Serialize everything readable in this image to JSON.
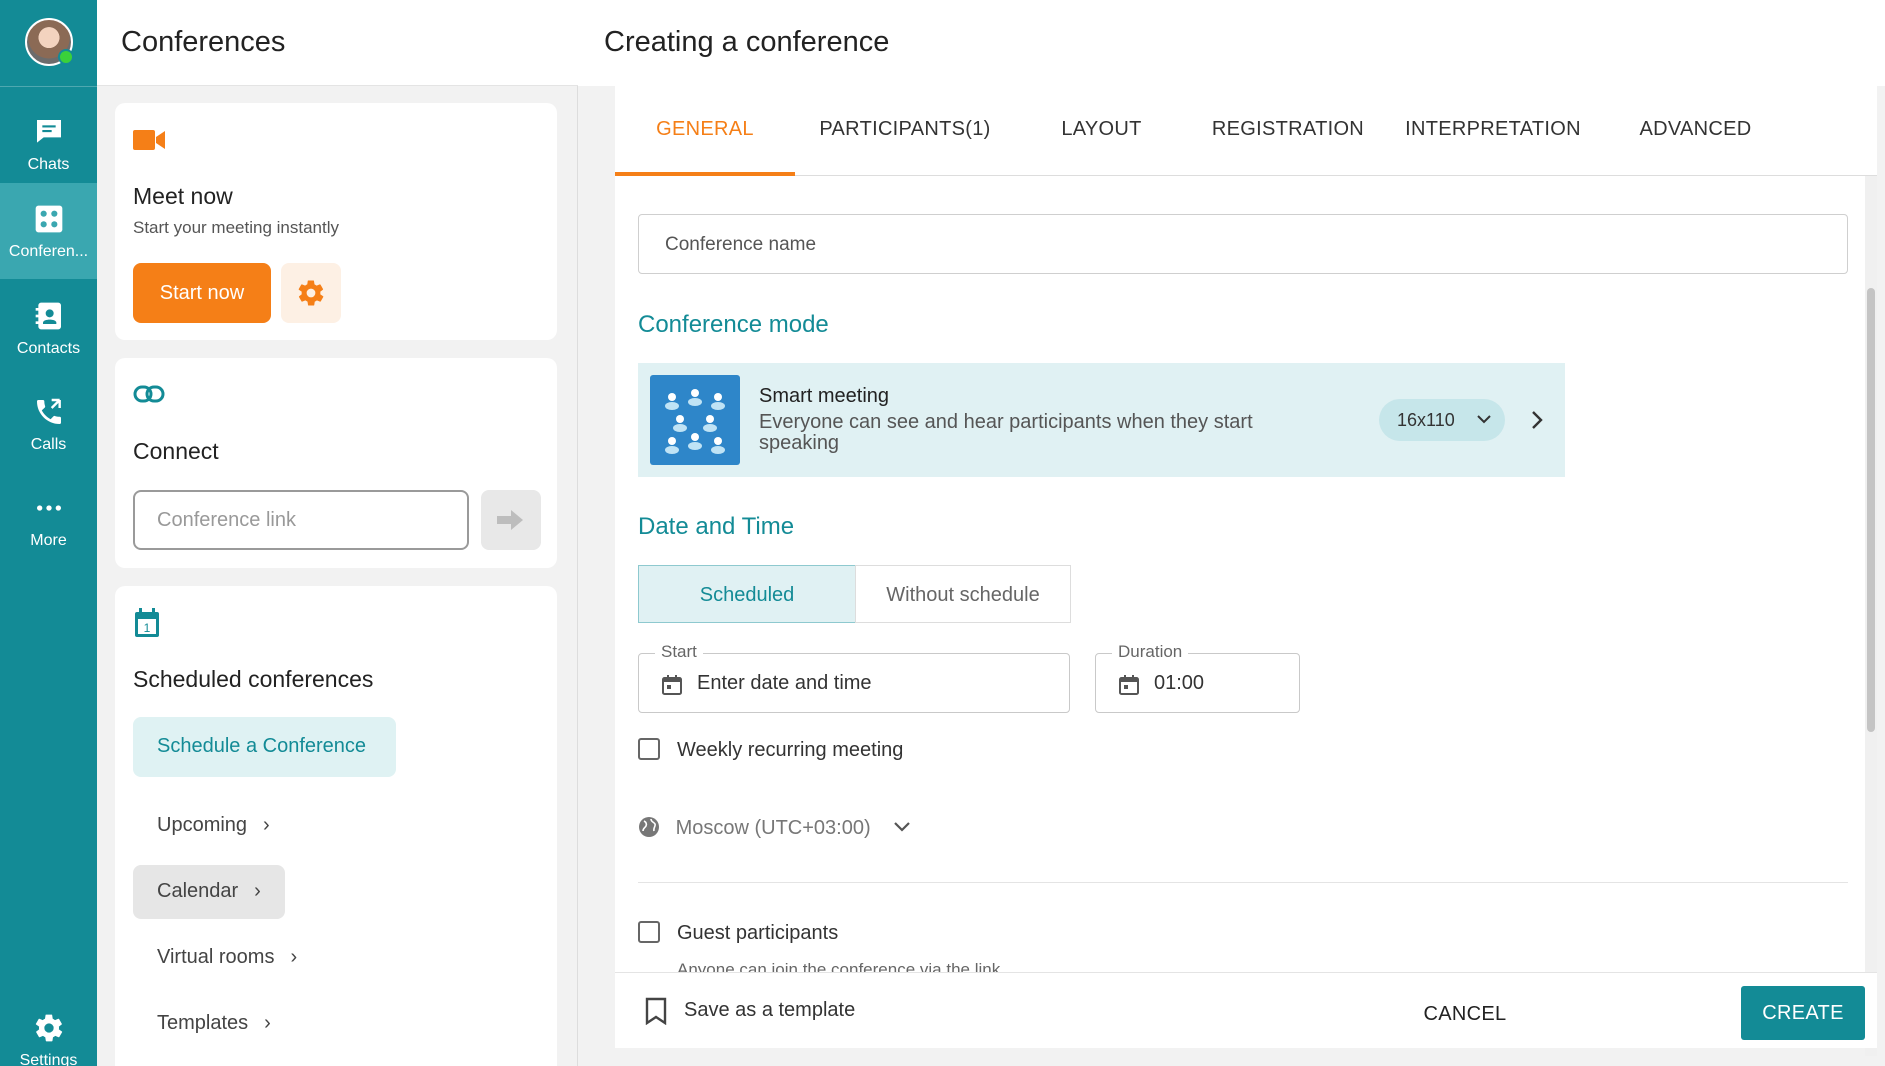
{
  "rail": {
    "items": [
      {
        "label": "Chats",
        "icon": "chat-icon"
      },
      {
        "label": "Conferen...",
        "icon": "conference-icon"
      },
      {
        "label": "Contacts",
        "icon": "contacts-icon"
      },
      {
        "label": "Calls",
        "icon": "phone-icon"
      },
      {
        "label": "More",
        "icon": "more-icon"
      },
      {
        "label": "Settings",
        "icon": "gear-icon"
      }
    ],
    "accent": "#138b96"
  },
  "left": {
    "title": "Conferences",
    "meet_now": {
      "title": "Meet now",
      "subtitle": "Start your meeting instantly",
      "start_label": "Start now"
    },
    "connect": {
      "title": "Connect",
      "placeholder": "Conference link"
    },
    "scheduled": {
      "title": "Scheduled conferences",
      "schedule_label": "Schedule a Conference",
      "menu": [
        {
          "label": "Upcoming"
        },
        {
          "label": "Calendar"
        },
        {
          "label": "Virtual rooms"
        },
        {
          "label": "Templates"
        }
      ]
    }
  },
  "main": {
    "title": "Creating a conference",
    "tabs": [
      {
        "label": "GENERAL"
      },
      {
        "label": "PARTICIPANTS(1)"
      },
      {
        "label": "LAYOUT"
      },
      {
        "label": "REGISTRATION"
      },
      {
        "label": "INTERPRETATION"
      },
      {
        "label": "ADVANCED"
      }
    ],
    "name_placeholder": "Conference name",
    "mode_section": "Conference mode",
    "mode": {
      "name": "Smart meeting",
      "description": "Everyone can see and hear participants when they start speaking",
      "size": "16x110"
    },
    "datetime_section": "Date and Time",
    "schedule_options": [
      "Scheduled",
      "Without schedule"
    ],
    "start": {
      "label": "Start",
      "value": "Enter date and time"
    },
    "duration": {
      "label": "Duration",
      "value": "01:00"
    },
    "weekly_label": "Weekly recurring meeting",
    "timezone": "Moscow (UTC+03:00)",
    "guest_label": "Guest participants",
    "guest_hint": "Anyone can join the conference via the link"
  },
  "footer": {
    "template_label": "Save as a template",
    "cancel_label": "CANCEL",
    "create_label": "CREATE"
  }
}
